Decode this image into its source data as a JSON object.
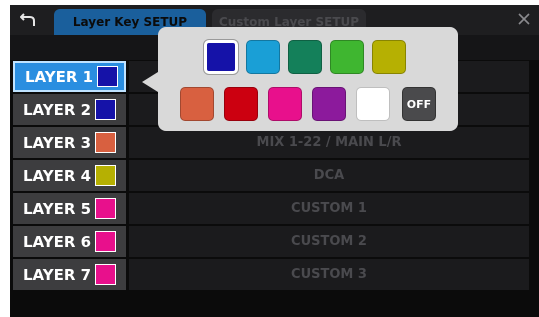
{
  "tabs": [
    {
      "label": "Layer Key SETUP",
      "active": true
    },
    {
      "label": "Custom Layer SETUP",
      "active": false
    }
  ],
  "icons": {
    "back": "back-arrow-icon",
    "close": "close-icon"
  },
  "layers": [
    {
      "label": "LAYER 1",
      "color": "#1512a8",
      "assignment": "",
      "selected": true
    },
    {
      "label": "LAYER 2",
      "color": "#1512a8",
      "assignment": ""
    },
    {
      "label": "LAYER 3",
      "color": "#d86040",
      "assignment": "MIX 1-22 / MAIN L/R"
    },
    {
      "label": "LAYER 4",
      "color": "#b6b002",
      "assignment": "DCA"
    },
    {
      "label": "LAYER 5",
      "color": "#e8108c",
      "assignment": "CUSTOM 1"
    },
    {
      "label": "LAYER 6",
      "color": "#e8108c",
      "assignment": "CUSTOM 2"
    },
    {
      "label": "LAYER 7",
      "color": "#e8108c",
      "assignment": "CUSTOM 3"
    }
  ],
  "palette": {
    "colors": [
      {
        "name": "blue",
        "hex": "#1512a8",
        "selected": true
      },
      {
        "name": "cyan",
        "hex": "#1a9fd6"
      },
      {
        "name": "dark-green",
        "hex": "#14805a"
      },
      {
        "name": "green",
        "hex": "#3fb630"
      },
      {
        "name": "olive",
        "hex": "#b6b002"
      },
      {
        "name": "orange",
        "hex": "#d86040"
      },
      {
        "name": "red",
        "hex": "#cc0010"
      },
      {
        "name": "pink",
        "hex": "#e8108c"
      },
      {
        "name": "purple",
        "hex": "#8c1a9c"
      },
      {
        "name": "white",
        "hex": "#ffffff"
      }
    ],
    "off_label": "OFF"
  }
}
